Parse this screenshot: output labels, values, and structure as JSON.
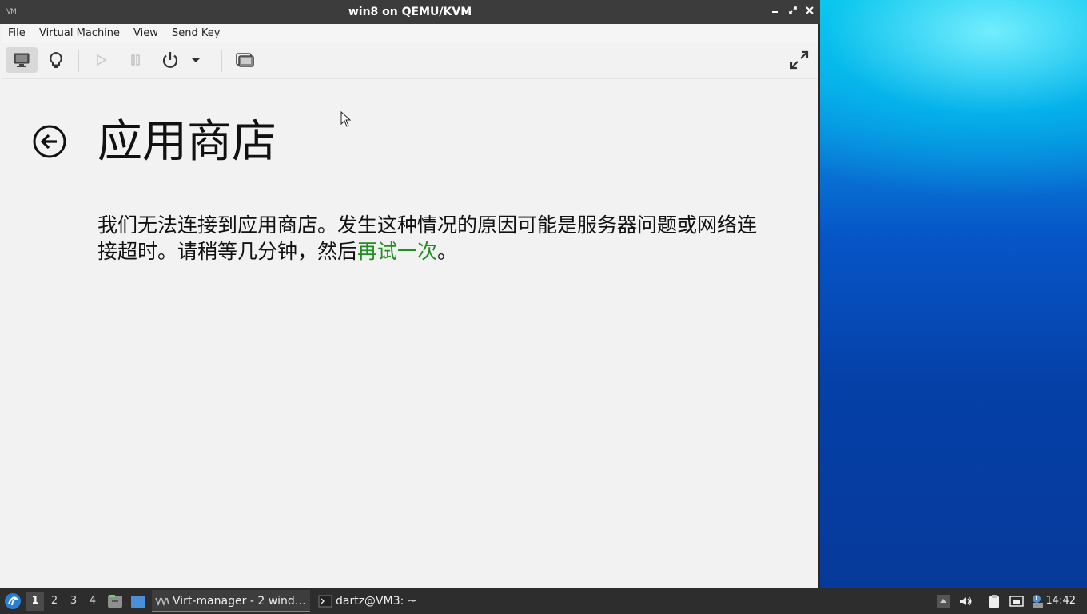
{
  "window": {
    "title": "win8 on QEMU/KVM",
    "app_icon_text": "VM"
  },
  "menubar": {
    "file": "File",
    "virtual_machine": "Virtual Machine",
    "view": "View",
    "send_key": "Send Key"
  },
  "toolbar": {
    "icons": [
      "console-icon",
      "details-lightbulb-icon",
      "run-icon",
      "pause-icon",
      "power-icon",
      "shutdown-menu-arrow-icon",
      "snapshots-icon",
      "fullscreen-icon"
    ]
  },
  "guest": {
    "page_title": "应用商店",
    "message_part1": "我们无法连接到应用商店。发生这种情况的原因可能是服务器问题或网络连接超时。请稍等几分钟，然后",
    "retry_link": "再试一次",
    "message_end": "。"
  },
  "taskbar": {
    "workspaces": [
      "1",
      "2",
      "3",
      "4"
    ],
    "active_workspace": "1",
    "tasks": [
      {
        "label": "Virt-manager - 2 wind…",
        "active": true
      },
      {
        "label": "dartz@VM3: ~",
        "active": false
      }
    ],
    "clock": "14:42"
  },
  "colors": {
    "titlebar": "#3c3c3c",
    "link_green": "#1f8f1f",
    "taskbar": "#2d2d2d",
    "accent_blue": "#4a90d9"
  }
}
